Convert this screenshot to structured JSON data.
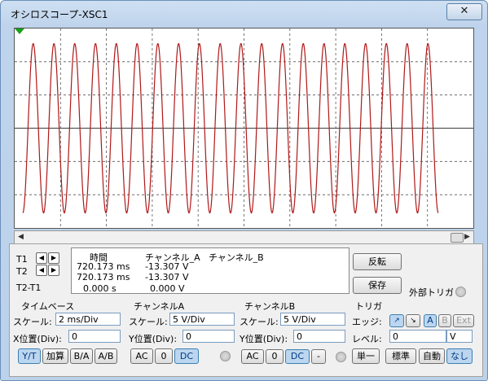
{
  "window": {
    "title": "オシロスコープ-XSC1",
    "close": "✕"
  },
  "scope": {
    "signal_color": "#b01818",
    "grid_color": "#555555"
  },
  "measure": {
    "hdr_time": "時間",
    "hdr_cha": "チャンネル_A",
    "hdr_chb": "チャンネル_B",
    "rows": [
      {
        "label": "T1",
        "time": "720.173 ms",
        "cha": "-13.307 V"
      },
      {
        "label": "T2",
        "time": "720.173 ms",
        "cha": "-13.307 V"
      },
      {
        "label": "T2-T1",
        "time": "0.000 s",
        "cha": "0.000 V"
      }
    ]
  },
  "buttons": {
    "reverse": "反転",
    "save": "保存",
    "ext_trigger": "外部トリガ"
  },
  "timebase": {
    "title": "タイムベース",
    "scale_label": "スケール:",
    "scale": "2 ms/Div",
    "pos_label": "X位置(Div):",
    "pos": "0",
    "modes": [
      "Y/T",
      "加算",
      "B/A",
      "A/B"
    ]
  },
  "channel_a": {
    "title": "チャンネルA",
    "scale_label": "スケール:",
    "scale": "5  V/Div",
    "pos_label": "Y位置(Div):",
    "pos": "0",
    "coupling": [
      "AC",
      "0",
      "DC"
    ]
  },
  "channel_b": {
    "title": "チャンネルB",
    "scale_label": "スケール:",
    "scale": "5  V/Div",
    "pos_label": "Y位置(Div):",
    "pos": "0",
    "coupling": [
      "AC",
      "0",
      "DC",
      "-"
    ]
  },
  "trigger": {
    "title": "トリガ",
    "edge_label": "エッジ:",
    "edge_rise": "↗",
    "edge_fall": "↘",
    "sources": [
      "A",
      "B",
      "Ext"
    ],
    "level_label": "レベル:",
    "level": "0",
    "level_unit": "V",
    "modes": [
      "単一",
      "標準",
      "自動",
      "なし"
    ]
  }
}
